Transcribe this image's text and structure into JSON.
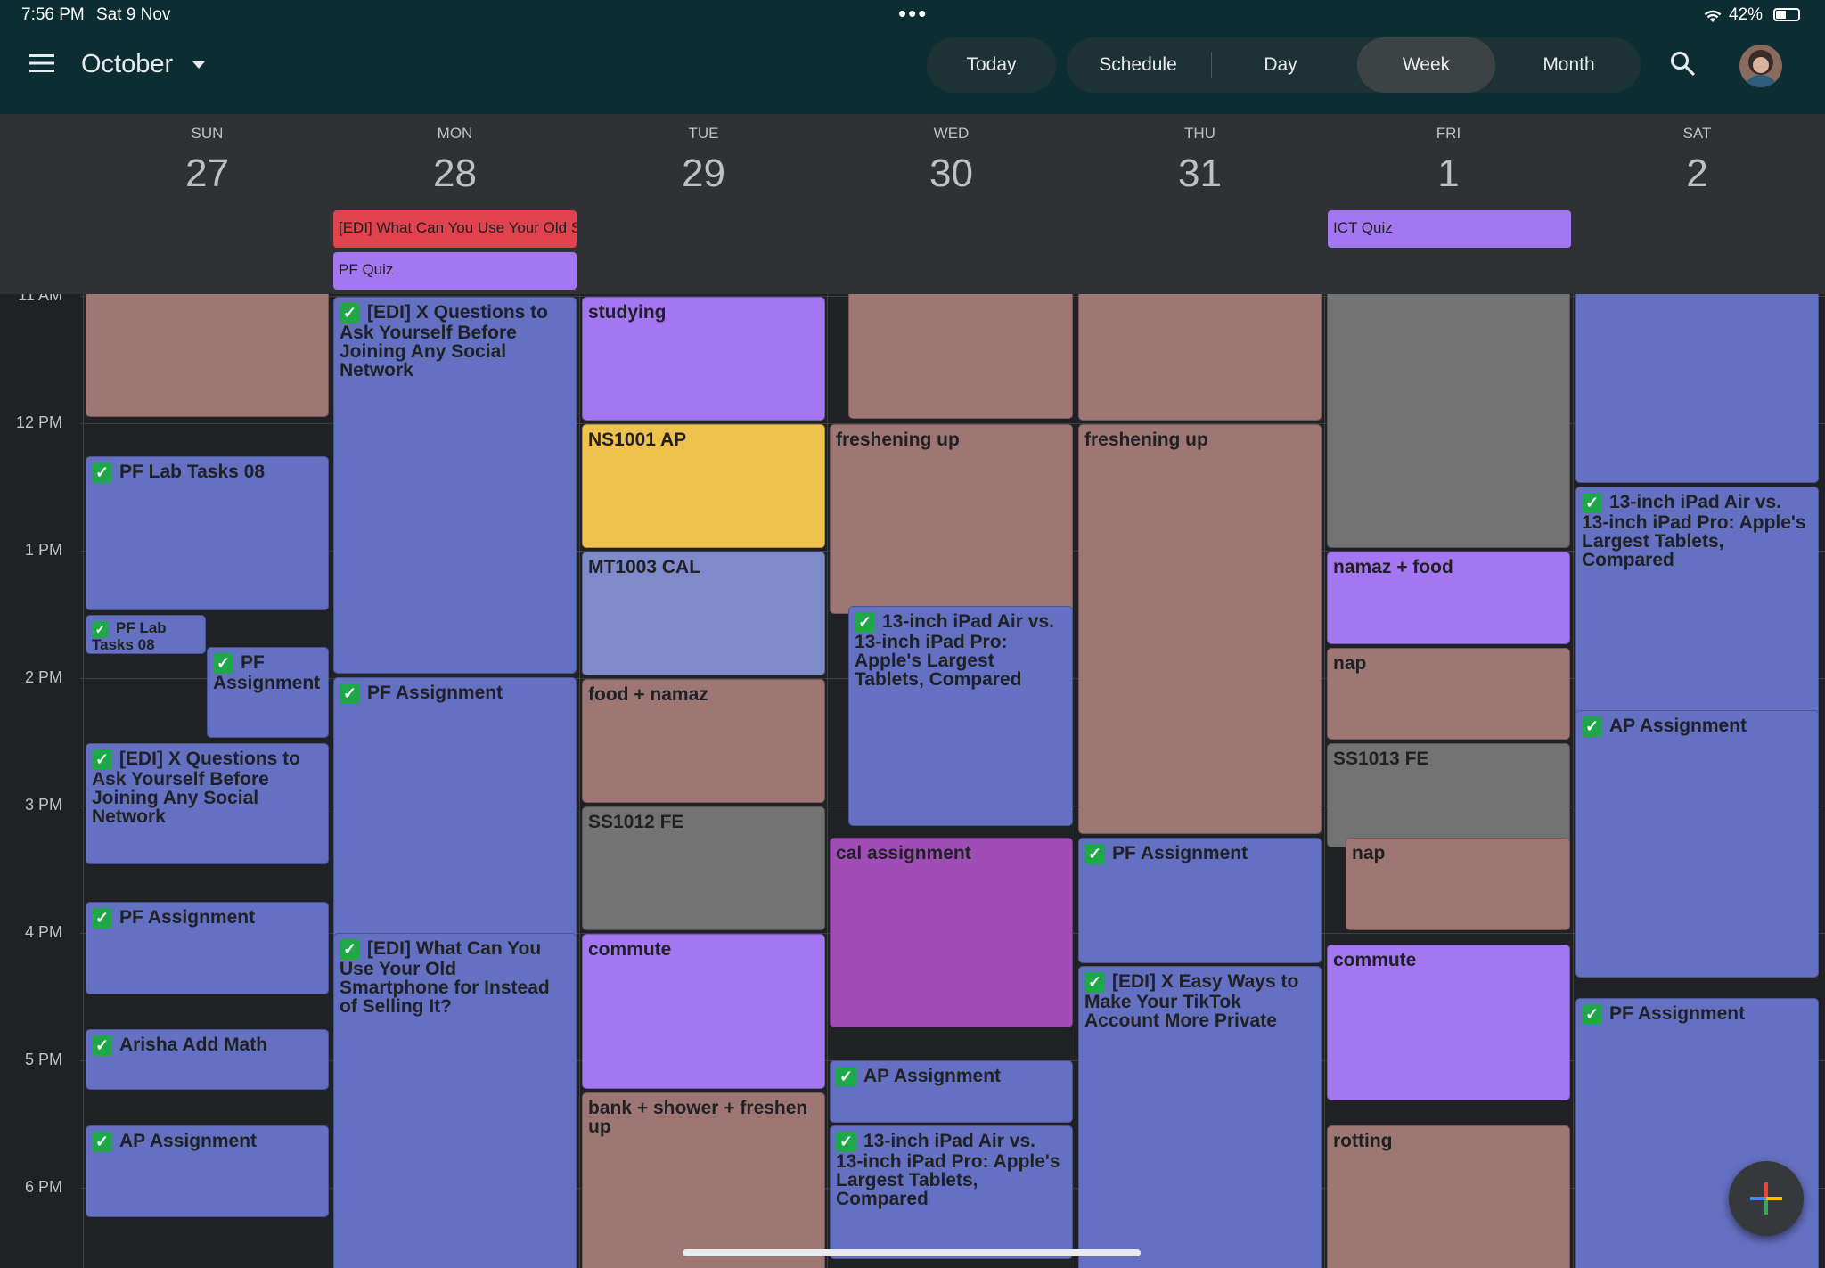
{
  "status_bar": {
    "time": "7:56 PM",
    "date": "Sat 9 Nov",
    "battery": "42%"
  },
  "header": {
    "month": "October"
  },
  "views": {
    "today": "Today",
    "schedule": "Schedule",
    "day": "Day",
    "week": "Week",
    "month": "Month",
    "active": "Week"
  },
  "days": [
    {
      "dow": "SUN",
      "num": "27"
    },
    {
      "dow": "MON",
      "num": "28"
    },
    {
      "dow": "TUE",
      "num": "29"
    },
    {
      "dow": "WED",
      "num": "30"
    },
    {
      "dow": "THU",
      "num": "31"
    },
    {
      "dow": "FRI",
      "num": "1"
    },
    {
      "dow": "SAT",
      "num": "2"
    }
  ],
  "all_day_events": [
    {
      "title": "[EDI] What Can You Use Your Old Smartphone for Instead of Selling It?",
      "color": "#e0434d"
    },
    {
      "title": "PF Quiz",
      "color": "#a576f1"
    },
    {
      "title": "ICT Quiz",
      "color": "#a576f1"
    }
  ],
  "hour_labels": [
    "11 AM",
    "12 PM",
    "1 PM",
    "2 PM",
    "3 PM",
    "4 PM",
    "5 PM",
    "6 PM"
  ],
  "events": [
    {
      "id": "sun-rose-top",
      "title": ""
    },
    {
      "id": "sun-pf-lab",
      "title": "PF Lab Tasks 08"
    },
    {
      "id": "sun-pf-lab-2",
      "title": "PF Lab Tasks 08"
    },
    {
      "id": "sun-pf-assign-1",
      "title": "PF Assignment"
    },
    {
      "id": "sun-edi",
      "title": "[EDI] X Questions to Ask Yourself Before Joining Any Social Network"
    },
    {
      "id": "sun-pf-assign-2",
      "title": "PF Assignment"
    },
    {
      "id": "sun-arisha",
      "title": "Arisha Add Math"
    },
    {
      "id": "sun-ap",
      "title": "AP Assignment"
    },
    {
      "id": "mon-edi-1",
      "title": "[EDI] X Questions to Ask Yourself Before Joining Any Social Network"
    },
    {
      "id": "mon-pf",
      "title": "PF Assignment"
    },
    {
      "id": "mon-edi-2",
      "title": "[EDI] What Can You Use Your Old Smartphone for Instead of Selling It?"
    },
    {
      "id": "tue-studying",
      "title": "studying"
    },
    {
      "id": "tue-ns",
      "title": "NS1001 AP"
    },
    {
      "id": "tue-mt",
      "title": "MT1003 CAL"
    },
    {
      "id": "tue-food",
      "title": "food + namaz"
    },
    {
      "id": "tue-ss",
      "title": "SS1012 FE"
    },
    {
      "id": "tue-commute",
      "title": "commute"
    },
    {
      "id": "tue-bank",
      "title": "bank + shower + freshen up"
    },
    {
      "id": "wed-rose-top",
      "title": ""
    },
    {
      "id": "wed-fresh",
      "title": "freshening up"
    },
    {
      "id": "wed-ipad-1",
      "title": "13-inch iPad Air vs. 13-inch iPad Pro: Apple's Largest Tablets, Compared"
    },
    {
      "id": "wed-cal",
      "title": "cal assignment"
    },
    {
      "id": "wed-ap",
      "title": "AP Assignment"
    },
    {
      "id": "wed-ipad-2",
      "title": "13-inch iPad Air vs. 13-inch iPad Pro: Apple's Largest Tablets, Compared"
    },
    {
      "id": "thu-rose-top",
      "title": ""
    },
    {
      "id": "thu-fresh",
      "title": "freshening up"
    },
    {
      "id": "thu-pf",
      "title": "PF Assignment"
    },
    {
      "id": "thu-edi",
      "title": "[EDI] X Easy Ways to Make Your TikTok Account More Private"
    },
    {
      "id": "fri-grey-top",
      "title": ""
    },
    {
      "id": "fri-namaz",
      "title": "namaz + food"
    },
    {
      "id": "fri-nap-1",
      "title": "nap"
    },
    {
      "id": "fri-ss",
      "title": "SS1013 FE"
    },
    {
      "id": "fri-nap-2",
      "title": "nap"
    },
    {
      "id": "fri-commute",
      "title": "commute"
    },
    {
      "id": "fri-rotting",
      "title": "rotting"
    },
    {
      "id": "sat-blue-top",
      "title": ""
    },
    {
      "id": "sat-ipad",
      "title": "13-inch iPad Air vs. 13-inch iPad Pro: Apple's Largest Tablets, Compared"
    },
    {
      "id": "sat-ap",
      "title": "AP Assignment"
    },
    {
      "id": "sat-pf",
      "title": "PF Assignment"
    }
  ],
  "icons": {
    "menu": "hamburger-icon",
    "dropdown": "caret-down-icon",
    "search": "search-icon",
    "add": "plus-icon",
    "check": "checkmark-icon"
  }
}
